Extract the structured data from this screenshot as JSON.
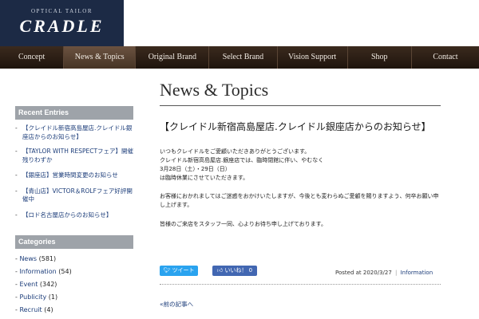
{
  "brand": {
    "sub": "OPTICAL TAILOR",
    "name": "CRADLE"
  },
  "nav": [
    {
      "label": "Concept"
    },
    {
      "label": "News & Topics"
    },
    {
      "label": "Original Brand"
    },
    {
      "label": "Select Brand"
    },
    {
      "label": "Vision Support"
    },
    {
      "label": "Shop"
    },
    {
      "label": "Contact"
    }
  ],
  "sidebar": {
    "recent_title": "Recent Entries",
    "recent": [
      "【クレイドル新宿高島屋店.クレイドル銀座店からのお知らせ】",
      "【TAYLOR WITH RESPECTフェア】開催残りわずか",
      "【銀座店】営業時間変更のお知らせ",
      "【青山店】VICTOR＆ROLFフェア好評開催中",
      "【ロド名古屋店からのお知らせ】"
    ],
    "categories_title": "Categories",
    "categories": [
      {
        "name": "News",
        "count": "(581)"
      },
      {
        "name": "Information",
        "count": "(54)"
      },
      {
        "name": "Event",
        "count": "(342)"
      },
      {
        "name": "Publicity",
        "count": "(1)"
      },
      {
        "name": "Recruit",
        "count": "(4)"
      }
    ]
  },
  "main": {
    "page_title": "News & Topics",
    "article_title": "【クレイドル新宿高島屋店.クレイドル銀座店からのお知らせ】",
    "para1": [
      "いつもクレイドルをご愛顧いただきありがとうございます。",
      "クレイドル新宿高島屋店.銀座店では、臨時閉館に伴い、やむなく",
      "3月28日（土）・29日（日）",
      "は臨時休業にさせていただきます。"
    ],
    "para2": [
      "お客様におかれましてはご迷惑をおかけいたしますが、今後とも変わらぬご愛顧を賜りますよう、何卒お願い申",
      "し上げます。"
    ],
    "para3": "皆様のご来店をスタッフ一同、心よりお待ち申し上げております。",
    "tweet_label": "ツイート",
    "like_label": "いいね！ 0",
    "posted_prefix": "Posted at 2020/3/27",
    "posted_sep": "|",
    "posted_category": "Information",
    "prev_link": "«前の記事へ"
  },
  "colors": {
    "logo_bg": "#1c2a45",
    "nav_bg": "#2e2016",
    "sidebar_head": "#9ea3a9",
    "link": "#1c3d7a",
    "tweet": "#2aa3ef",
    "like": "#4267b2"
  }
}
